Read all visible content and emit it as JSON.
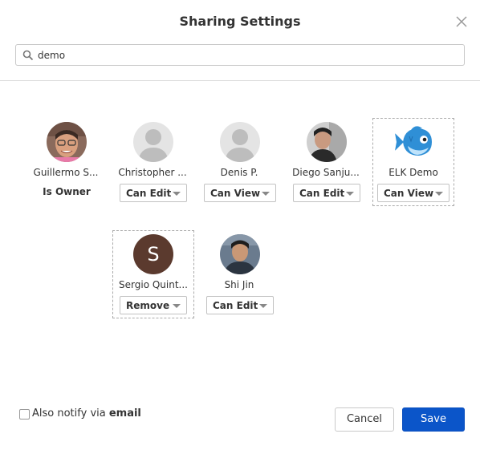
{
  "dialog": {
    "title": "Sharing Settings",
    "close_icon": "close-icon"
  },
  "search": {
    "value": "demo",
    "icon": "search-icon"
  },
  "users": [
    {
      "name": "Guillermo S...",
      "permission": "Is Owner",
      "avatar": "photo"
    },
    {
      "name": "Christopher ...",
      "permission": "Can Edit",
      "avatar": "placeholder"
    },
    {
      "name": "Denis P.",
      "permission": "Can View",
      "avatar": "placeholder"
    },
    {
      "name": "Diego Sanju...",
      "permission": "Can Edit",
      "avatar": "photo"
    },
    {
      "name": "ELK Demo",
      "permission": "Can View",
      "avatar": "fish-logo"
    },
    {
      "name": "Sergio Quint...",
      "permission": "Remove",
      "avatar": "initial",
      "initial": "S",
      "avatar_color": "#5b3a2e"
    },
    {
      "name": "Shi Jin",
      "permission": "Can Edit",
      "avatar": "photo"
    }
  ],
  "footer": {
    "notify_prefix": "Also notify via ",
    "notify_bold": "email",
    "notify_checked": false,
    "cancel_label": "Cancel",
    "save_label": "Save"
  },
  "colors": {
    "primary": "#0b55c9",
    "placeholder_avatar": "#d6d6d6"
  }
}
